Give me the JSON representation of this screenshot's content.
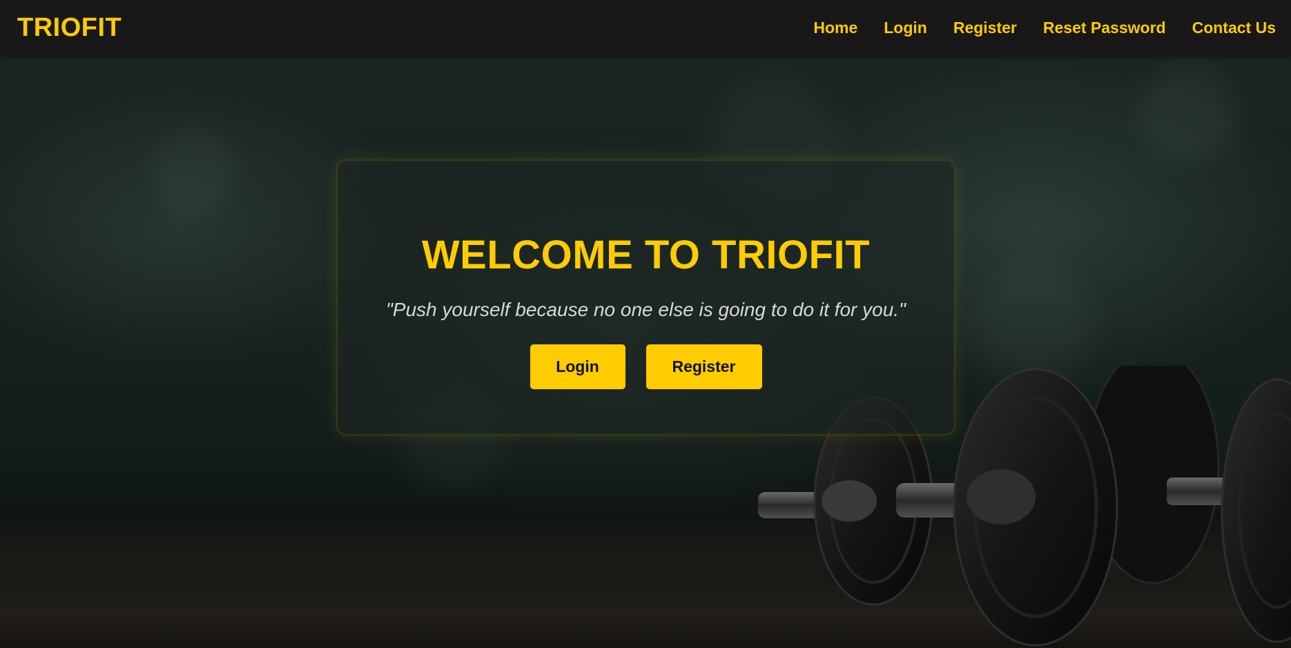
{
  "navbar": {
    "brand": "TRIOFIT",
    "links": [
      "Home",
      "Login",
      "Register",
      "Reset Password",
      "Contact Us"
    ]
  },
  "hero": {
    "title": "WELCOME TO TRIOFIT",
    "quote": "\"Push yourself because no one else is going to do it for you.\"",
    "buttons": {
      "login": "Login",
      "register": "Register"
    },
    "background_image": "dumbbells-on-dark-textured-wall"
  },
  "colors": {
    "accent": "#ffcc00",
    "navbar_bg": "#181818",
    "quote_text": "#d9d9d9",
    "button_text": "#111111"
  }
}
